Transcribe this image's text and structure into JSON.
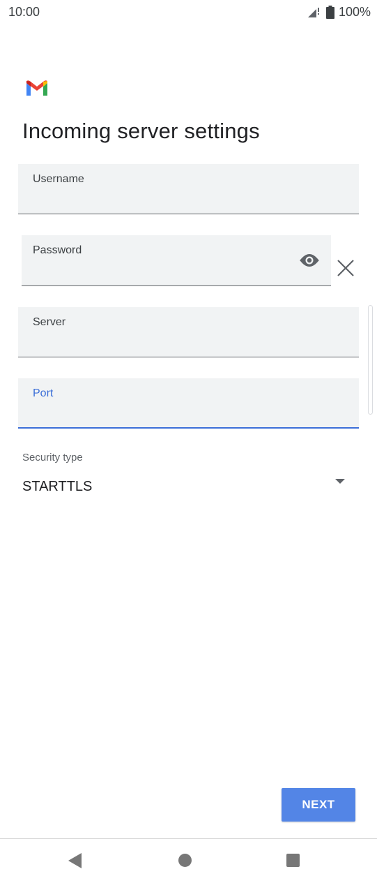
{
  "status_bar": {
    "time": "10:00",
    "battery": "100%",
    "icons": [
      "signal-icon",
      "battery-icon"
    ]
  },
  "app": {
    "logo": "gmail-logo"
  },
  "page": {
    "title": "Incoming server settings"
  },
  "form": {
    "username": {
      "label": "Username",
      "value": ""
    },
    "password": {
      "label": "Password",
      "value": "",
      "icons": [
        "eye-icon",
        "close-icon"
      ]
    },
    "server": {
      "label": "Server",
      "value": ""
    },
    "port": {
      "label": "Port",
      "value": "",
      "focused": true
    },
    "security_type": {
      "label": "Security type",
      "value": "STARTTLS"
    }
  },
  "actions": {
    "next_label": "NEXT"
  },
  "navigation": {
    "icons": [
      "back-icon",
      "home-icon",
      "recents-icon"
    ]
  },
  "colors": {
    "accent": "#3c6fd8",
    "button": "#5385e6",
    "field_background": "#f1f3f4"
  }
}
